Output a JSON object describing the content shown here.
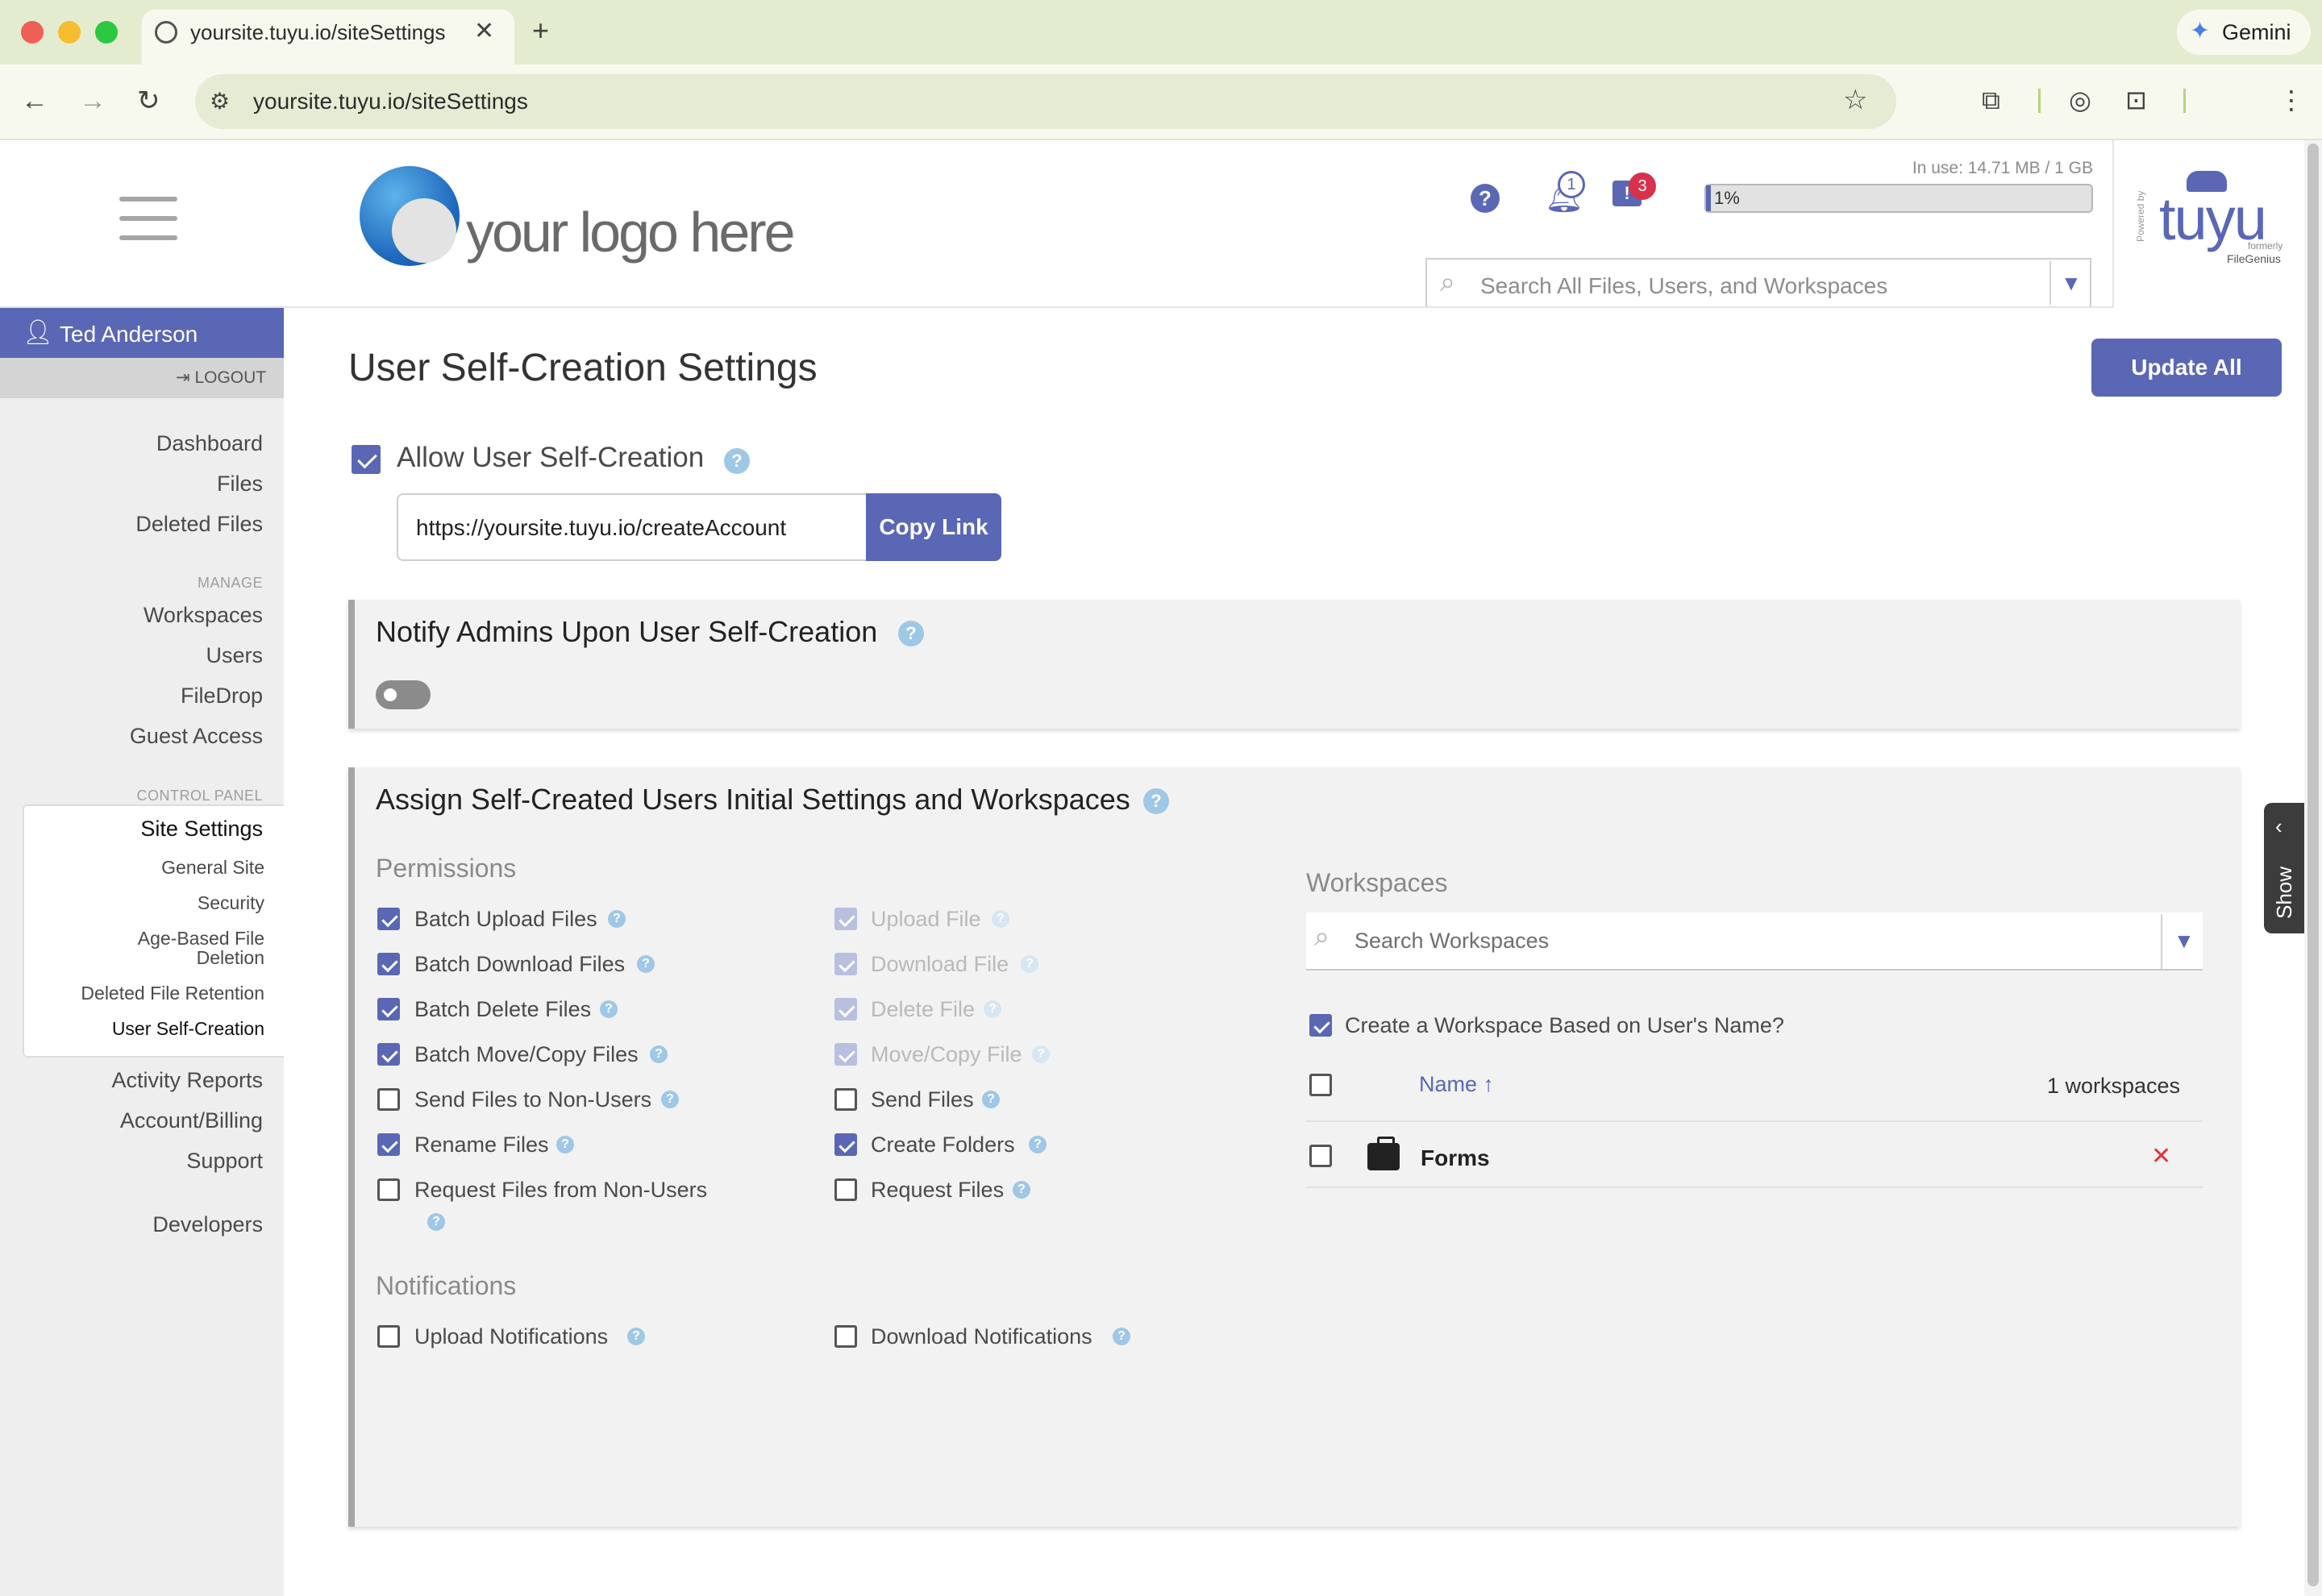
{
  "browser": {
    "tab_title": "yoursite.tuyu.io/siteSettings",
    "url": "yoursite.tuyu.io/siteSettings",
    "gemini_label": "Gemini",
    "new_tab_label": "+",
    "close_label": "✕"
  },
  "header": {
    "logo_text": "your logo here",
    "usage_text": "In use: 14.71 MB / 1 GB",
    "usage_percent": "1%",
    "usage_fraction": 0.01,
    "notifications_count": "1",
    "messages_count": "3",
    "help_label": "?",
    "search_placeholder": "Search All Files, Users, and Workspaces",
    "brand": "tuyu",
    "brand_powered": "Powered by",
    "brand_formerly": "formerly",
    "brand_former_name": "FileGenius"
  },
  "sidebar": {
    "user_name": "Ted Anderson",
    "logout_label": "LOGOUT",
    "main_items": [
      "Dashboard",
      "Files",
      "Deleted Files"
    ],
    "manage_section": "MANAGE",
    "manage_items": [
      "Workspaces",
      "Users",
      "FileDrop",
      "Guest Access"
    ],
    "control_section": "CONTROL PANEL",
    "site_settings_label": "Site Settings",
    "sub_items": [
      "General Site",
      "Security",
      "Age-Based File",
      "Deletion",
      "Deleted File Retention",
      "User Self-Creation"
    ],
    "bottom_items": [
      "Activity Reports",
      "Account/Billing",
      "Support",
      "Developers"
    ]
  },
  "main": {
    "page_title": "User Self-Creation Settings",
    "update_all_label": "Update All",
    "allow_label": "Allow User Self-Creation",
    "create_link": "https://yoursite.tuyu.io/createAccount",
    "copy_link_label": "Copy Link",
    "notify_title": "Notify Admins Upon User Self-Creation",
    "notify_enabled": false,
    "assign_title": "Assign Self-Created Users Initial Settings and Workspaces",
    "permissions_label": "Permissions",
    "permissions_left": [
      {
        "label": "Batch Upload Files",
        "checked": true
      },
      {
        "label": "Batch Download Files",
        "checked": true
      },
      {
        "label": "Batch Delete Files",
        "checked": true
      },
      {
        "label": "Batch Move/Copy Files",
        "checked": true
      },
      {
        "label": "Send Files to Non-Users",
        "checked": false
      },
      {
        "label": "Rename Files",
        "checked": true
      },
      {
        "label": "Request Files from Non-Users",
        "checked": false
      }
    ],
    "permissions_right": [
      {
        "label": "Upload File",
        "checked": true,
        "disabled": true
      },
      {
        "label": "Download File",
        "checked": true,
        "disabled": true
      },
      {
        "label": "Delete File",
        "checked": true,
        "disabled": true
      },
      {
        "label": "Move/Copy File",
        "checked": true,
        "disabled": true
      },
      {
        "label": "Send Files",
        "checked": false
      },
      {
        "label": "Create Folders",
        "checked": true
      },
      {
        "label": "Request Files",
        "checked": false
      }
    ],
    "notifications_label": "Notifications",
    "notifications": [
      {
        "label": "Upload Notifications",
        "checked": false
      },
      {
        "label": "Download Notifications",
        "checked": false
      }
    ],
    "workspaces_label": "Workspaces",
    "workspace_search_placeholder": "Search Workspaces",
    "create_ws_label": "Create a Workspace Based on User's Name?",
    "table_name_header": "Name",
    "table_count": "1 workspaces",
    "rows": [
      {
        "name": "Forms"
      }
    ],
    "help_label": "?",
    "show_label": "Show"
  },
  "colors": {
    "accent": "#5a67b5",
    "help_bubble": "#9fc7e6",
    "danger": "#e03535",
    "badge_red": "#d9304b"
  }
}
